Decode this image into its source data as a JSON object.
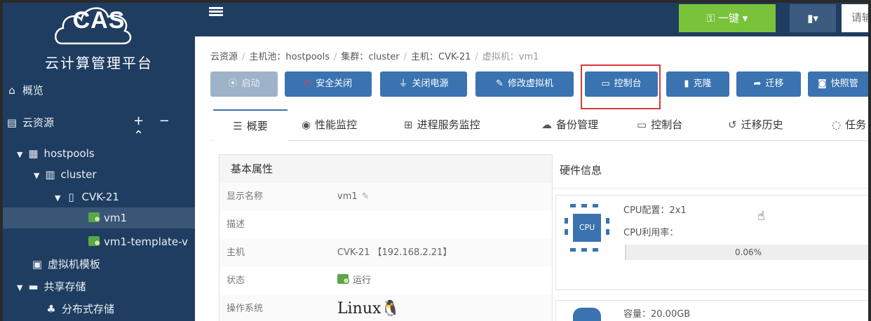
{
  "app": {
    "logo_text": "CAS",
    "title": "云计算管理平台"
  },
  "sidebar": {
    "overview": "概览",
    "cloud_resources": "云资源",
    "actions": "+ − ⌃",
    "tree": [
      {
        "label": "hostpools",
        "icon": "server-group-icon"
      },
      {
        "label": "cluster",
        "icon": "cluster-icon"
      },
      {
        "label": "CVK-21",
        "icon": "host-icon"
      },
      {
        "label": "vm1",
        "icon": "vm-icon",
        "selected": true
      },
      {
        "label": "vm1-template-v",
        "icon": "vm-icon"
      }
    ],
    "vm_templates": "虚拟机模板",
    "shared_storage": "共享存储",
    "distributed_storage": "分布式存储"
  },
  "topbar": {
    "onekey_label": "一键 ▾",
    "user_label": "▾",
    "search_placeholder": "请输"
  },
  "breadcrumb": {
    "items": [
      "云资源",
      "主机池：hostpools",
      "集群：cluster",
      "主机：CVK-21",
      "虚拟机：vm1"
    ]
  },
  "toolbar": {
    "buttons": [
      {
        "label": "启动",
        "icon": "power-on-icon",
        "disabled": true
      },
      {
        "label": "安全关闭",
        "icon": "shutdown-icon"
      },
      {
        "label": "关闭电源",
        "icon": "plug-icon"
      },
      {
        "label": "修改虚拟机",
        "icon": "pencil-icon"
      },
      {
        "label": "控制台",
        "icon": "console-icon"
      },
      {
        "label": "克隆",
        "icon": "clone-icon"
      },
      {
        "label": "迁移",
        "icon": "migrate-icon"
      },
      {
        "label": "快照管",
        "icon": "camera-icon"
      }
    ]
  },
  "tabs": [
    {
      "label": "概要",
      "icon": "list-icon",
      "active": true
    },
    {
      "label": "性能监控",
      "icon": "monitor-icon"
    },
    {
      "label": "进程服务监控",
      "icon": "process-icon"
    },
    {
      "label": "备份管理",
      "icon": "backup-icon"
    },
    {
      "label": "控制台",
      "icon": "console-icon"
    },
    {
      "label": "迁移历史",
      "icon": "history-icon"
    },
    {
      "label": "任务",
      "icon": "task-icon"
    }
  ],
  "basic_props": {
    "title": "基本属性",
    "rows": [
      {
        "label": "显示名称",
        "value": "vm1"
      },
      {
        "label": "描述",
        "value": ""
      },
      {
        "label": "主机",
        "value": "CVK-21 【192.168.2.21】"
      },
      {
        "label": "状态",
        "value": "运行"
      },
      {
        "label": "操作系统",
        "value": "Linux"
      }
    ]
  },
  "hardware": {
    "title": "硬件信息",
    "cpu_icon_label": "CPU",
    "cpu_config": "CPU配置：2x1",
    "cpu_usage_label": "CPU利用率：",
    "cpu_usage_value": "0.06%",
    "cpu_usage_fraction": 0.0006,
    "storage_capacity": "容量：20.00GB"
  },
  "colors": {
    "sidebar_bg": "#1f3d60",
    "primary_button": "#3a73b0",
    "accent_green": "#79c33b",
    "highlight_red": "#d83a3a"
  }
}
